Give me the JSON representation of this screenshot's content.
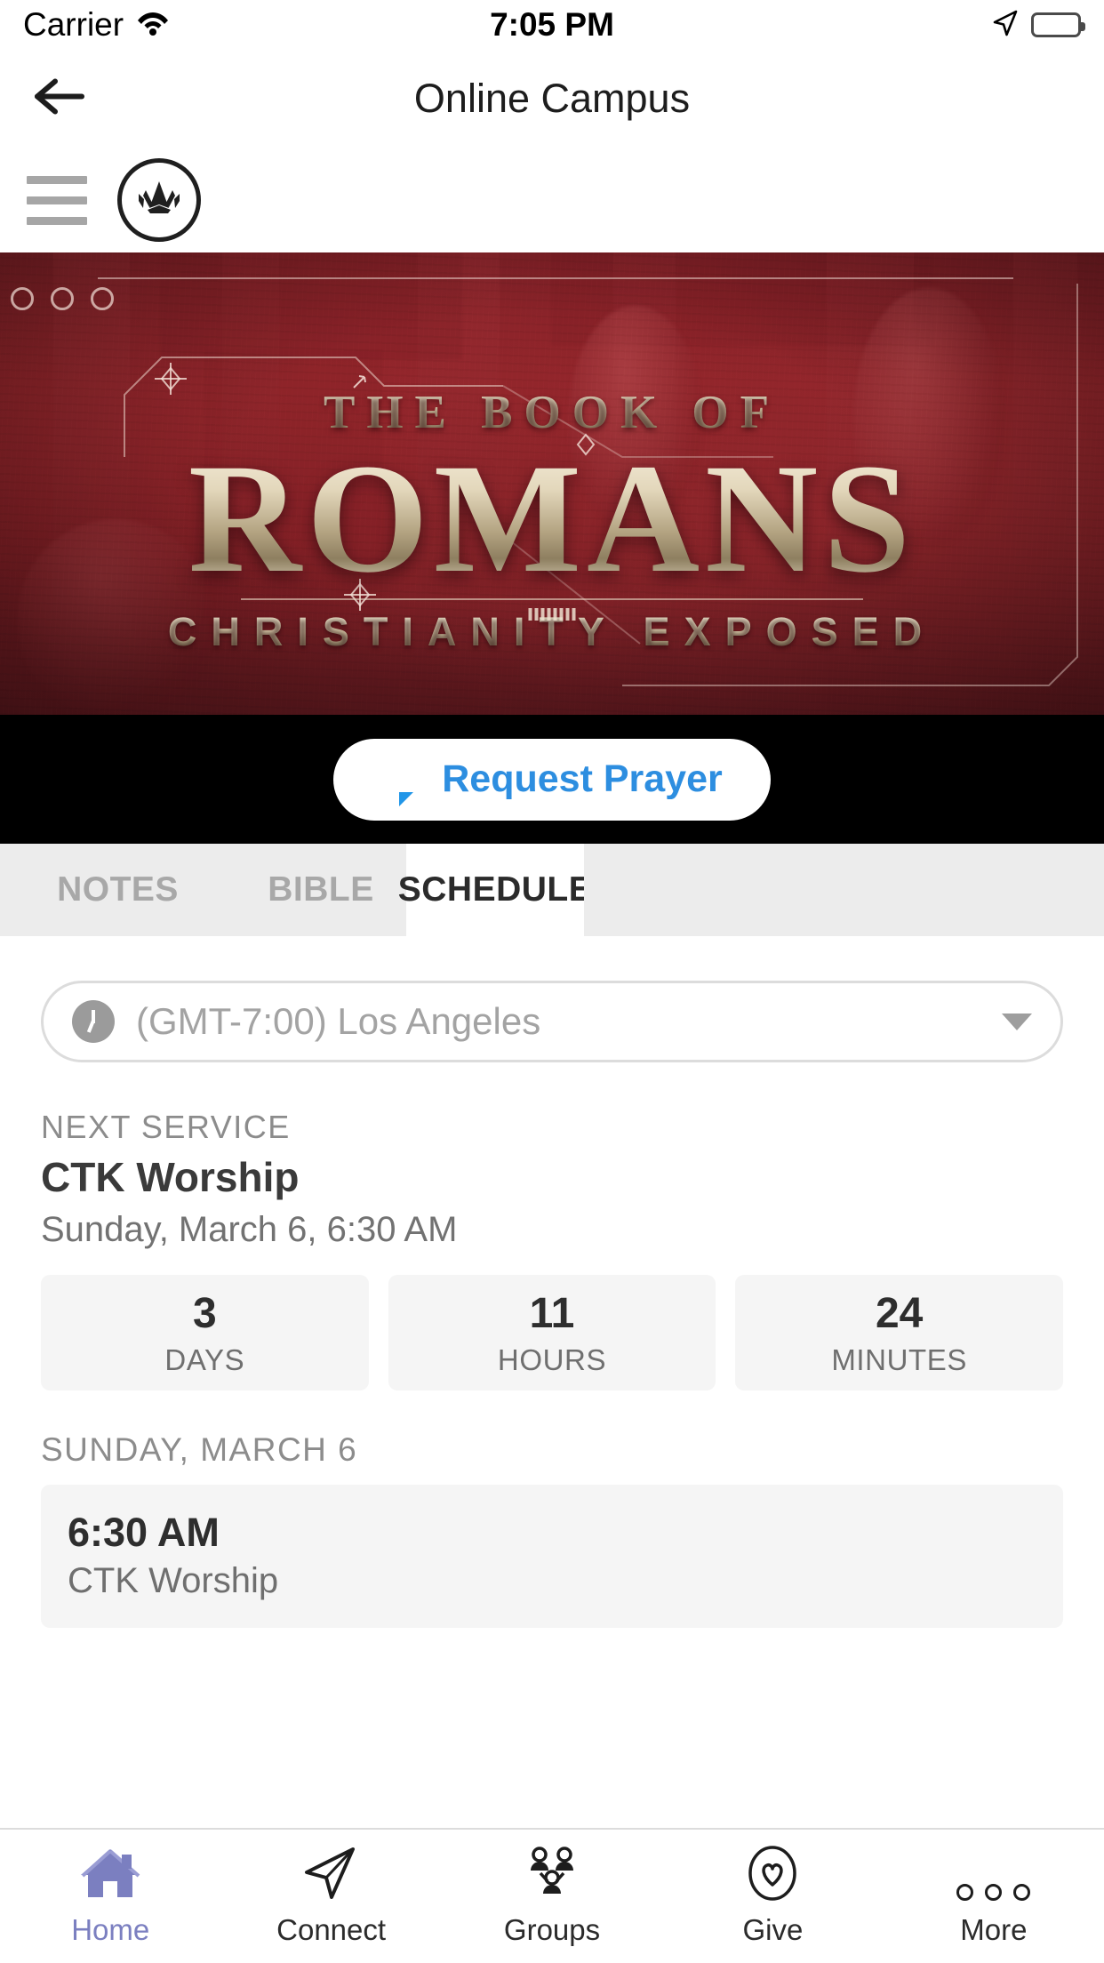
{
  "status_bar": {
    "carrier": "Carrier",
    "time": "7:05 PM",
    "wifi_icon": "wifi-icon",
    "location_icon": "location-arrow-icon",
    "battery_icon": "battery-full-icon"
  },
  "nav": {
    "title": "Online Campus",
    "back_icon": "back-arrow-icon"
  },
  "brand": {
    "menu_icon": "hamburger-menu-icon",
    "logo_icon": "crown-logo-icon"
  },
  "hero": {
    "eyebrow": "THE BOOK OF",
    "title": "ROMANS",
    "subtitle": "CHRISTIANITY EXPOSED",
    "background_color": "#7e1f26"
  },
  "prayer": {
    "label": "Request Prayer",
    "icon": "chat-bubble-icon",
    "accent_color": "#2d8ee0"
  },
  "tabs": [
    {
      "label": "NOTES",
      "active": false
    },
    {
      "label": "BIBLE",
      "active": false
    },
    {
      "label": "SCHEDULE",
      "active": true
    }
  ],
  "timezone": {
    "icon": "clock-icon",
    "value": "(GMT-7:00) Los Angeles",
    "caret_icon": "chevron-down-icon"
  },
  "next_service": {
    "label": "NEXT SERVICE",
    "title": "CTK Worship",
    "datetime": "Sunday, March 6, 6:30 AM"
  },
  "countdown": [
    {
      "value": "3",
      "unit": "DAYS"
    },
    {
      "value": "11",
      "unit": "HOURS"
    },
    {
      "value": "24",
      "unit": "MINUTES"
    }
  ],
  "schedule": {
    "day_header": "SUNDAY, MARCH 6",
    "items": [
      {
        "time": "6:30 AM",
        "name": "CTK Worship"
      }
    ]
  },
  "bottom_nav": {
    "active_color": "#7b7fc0",
    "items": [
      {
        "label": "Home",
        "icon": "home-icon",
        "active": true
      },
      {
        "label": "Connect",
        "icon": "paper-plane-icon",
        "active": false
      },
      {
        "label": "Groups",
        "icon": "people-group-icon",
        "active": false
      },
      {
        "label": "Give",
        "icon": "heart-circle-icon",
        "active": false
      },
      {
        "label": "More",
        "icon": "ellipsis-icon",
        "active": false
      }
    ]
  }
}
